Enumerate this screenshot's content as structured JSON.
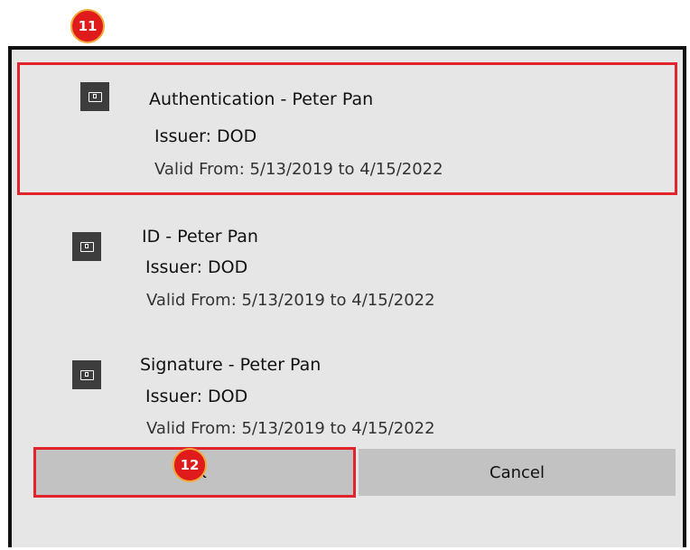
{
  "callouts": {
    "first": "11",
    "second": "12"
  },
  "certificates": [
    {
      "title": "Authentication - Peter Pan",
      "issuer": "Issuer: DOD",
      "valid": "Valid From: 5/13/2019 to 4/15/2022",
      "icon": "certificate-icon",
      "selected": true
    },
    {
      "title": "ID - Peter Pan",
      "issuer": "Issuer: DOD",
      "valid": "Valid From: 5/13/2019 to 4/15/2022",
      "icon": "certificate-icon",
      "selected": false
    },
    {
      "title": "Signature - Peter Pan",
      "issuer": "Issuer: DOD",
      "valid": "Valid From: 5/13/2019 to 4/15/2022",
      "icon": "certificate-icon",
      "selected": false
    }
  ],
  "buttons": {
    "ok": "OK",
    "cancel": "Cancel"
  },
  "colors": {
    "highlight": "#e3232b",
    "callout_fill": "#e01b1b",
    "callout_ring": "#f2a93b",
    "dialog_bg": "#e6e6e6",
    "button_bg": "#c2c2c2",
    "icon_bg": "#3d3d3d"
  }
}
